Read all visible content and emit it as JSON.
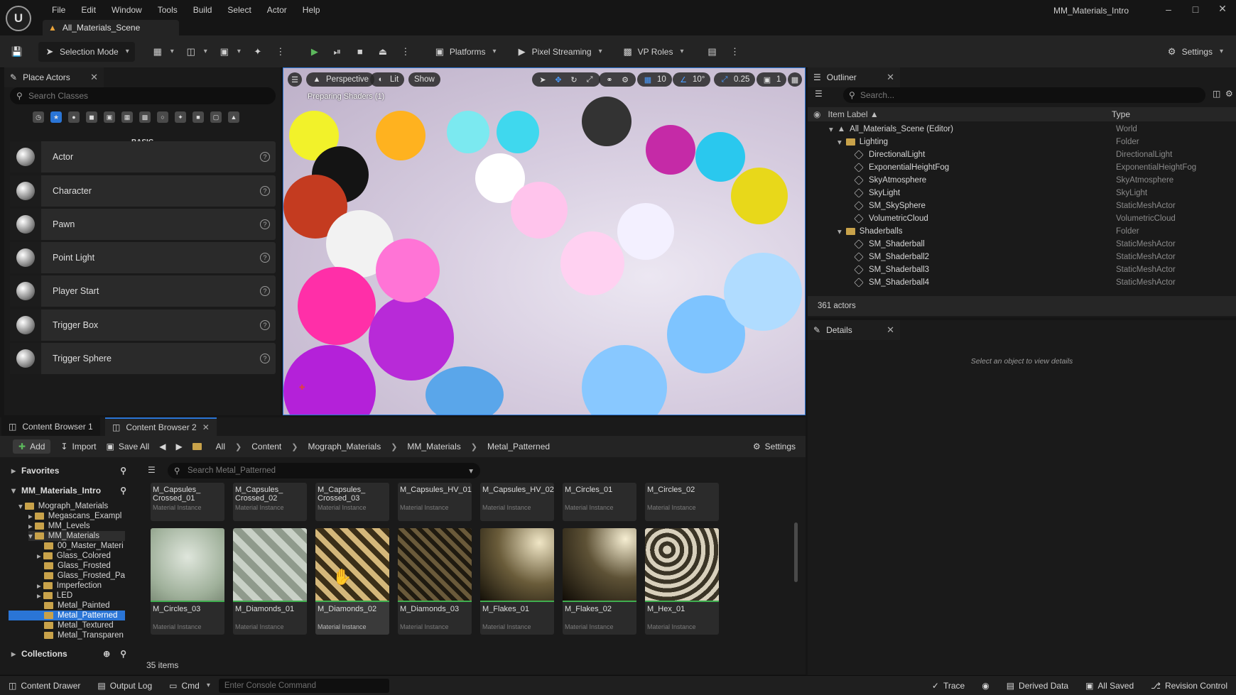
{
  "window": {
    "project_name": "MM_Materials_Intro",
    "level_tab": "All_Materials_Scene",
    "minimize": "–",
    "maximize": "□",
    "close": "✕"
  },
  "menu": [
    "File",
    "Edit",
    "Window",
    "Tools",
    "Build",
    "Select",
    "Actor",
    "Help"
  ],
  "toolbar": {
    "selection_mode": "Selection Mode",
    "platforms": "Platforms",
    "pixel_streaming": "Pixel Streaming",
    "vp_roles": "VP Roles",
    "settings": "Settings"
  },
  "place_actors": {
    "title": "Place Actors",
    "search_placeholder": "Search Classes",
    "section_label": "BASIC",
    "items": [
      {
        "label": "Actor"
      },
      {
        "label": "Character"
      },
      {
        "label": "Pawn"
      },
      {
        "label": "Point Light"
      },
      {
        "label": "Player Start"
      },
      {
        "label": "Trigger Box"
      },
      {
        "label": "Trigger Sphere"
      }
    ]
  },
  "viewport": {
    "perspective": "Perspective",
    "lit": "Lit",
    "show": "Show",
    "grid_snap": "10",
    "rotate_snap": "10°",
    "scale_snap": "0.25",
    "camera_speed": "1",
    "status": "Preparing Shaders (1)"
  },
  "outliner": {
    "title": "Outliner",
    "search_placeholder": "Search...",
    "col_label": "Item Label ▲",
    "col_type": "Type",
    "rows": [
      {
        "label": "All_Materials_Scene (Editor)",
        "type": "World"
      },
      {
        "label": "Lighting",
        "type": "Folder"
      },
      {
        "label": "DirectionalLight",
        "type": "DirectionalLight"
      },
      {
        "label": "ExponentialHeightFog",
        "type": "ExponentialHeightFog"
      },
      {
        "label": "SkyAtmosphere",
        "type": "SkyAtmosphere"
      },
      {
        "label": "SkyLight",
        "type": "SkyLight"
      },
      {
        "label": "SM_SkySphere",
        "type": "StaticMeshActor"
      },
      {
        "label": "VolumetricCloud",
        "type": "VolumetricCloud"
      },
      {
        "label": "Shaderballs",
        "type": "Folder"
      },
      {
        "label": "SM_Shaderball",
        "type": "StaticMeshActor"
      },
      {
        "label": "SM_Shaderball2",
        "type": "StaticMeshActor"
      },
      {
        "label": "SM_Shaderball3",
        "type": "StaticMeshActor"
      },
      {
        "label": "SM_Shaderball4",
        "type": "StaticMeshActor"
      }
    ],
    "count": "361 actors"
  },
  "details": {
    "title": "Details",
    "empty": "Select an object to view details"
  },
  "content_browser": {
    "tab1": "Content Browser 1",
    "tab2": "Content Browser 2",
    "add": "Add",
    "import": "Import",
    "save_all": "Save All",
    "settings": "Settings",
    "breadcrumbs": [
      "All",
      "Content",
      "Mograph_Materials",
      "MM_Materials",
      "Metal_Patterned"
    ],
    "favorites": "Favorites",
    "project": "MM_Materials_Intro",
    "collections": "Collections",
    "search_placeholder": "Search Metal_Patterned",
    "tree": [
      {
        "label": "Mograph_Materials"
      },
      {
        "label": "Megascans_Exampl"
      },
      {
        "label": "MM_Levels"
      },
      {
        "label": "MM_Materials"
      },
      {
        "label": "00_Master_Materi"
      },
      {
        "label": "Glass_Colored"
      },
      {
        "label": "Glass_Frosted"
      },
      {
        "label": "Glass_Frosted_Pa"
      },
      {
        "label": "Imperfection"
      },
      {
        "label": "LED"
      },
      {
        "label": "Metal_Painted"
      },
      {
        "label": "Metal_Patterned"
      },
      {
        "label": "Metal_Textured"
      },
      {
        "label": "Metal_Transparen"
      }
    ],
    "top_assets": [
      {
        "name": "M_Capsules_\nCrossed_01",
        "type": "Material Instance"
      },
      {
        "name": "M_Capsules_\nCrossed_02",
        "type": "Material Instance"
      },
      {
        "name": "M_Capsules_\nCrossed_03",
        "type": "Material Instance"
      },
      {
        "name": "M_Capsules_HV_01",
        "type": "Material Instance"
      },
      {
        "name": "M_Capsules_HV_02",
        "type": "Material Instance"
      },
      {
        "name": "M_Circles_01",
        "type": "Material Instance"
      },
      {
        "name": "M_Circles_02",
        "type": "Material Instance"
      }
    ],
    "assets": [
      {
        "name": "M_Circles_03",
        "type": "Material Instance"
      },
      {
        "name": "M_Diamonds_01",
        "type": "Material Instance"
      },
      {
        "name": "M_Diamonds_02",
        "type": "Material Instance"
      },
      {
        "name": "M_Diamonds_03",
        "type": "Material Instance"
      },
      {
        "name": "M_Flakes_01",
        "type": "Material Instance"
      },
      {
        "name": "M_Flakes_02",
        "type": "Material Instance"
      },
      {
        "name": "M_Hex_01",
        "type": "Material Instance"
      }
    ],
    "items_count": "35 items"
  },
  "statusbar": {
    "content_drawer": "Content Drawer",
    "output_log": "Output Log",
    "cmd": "Cmd",
    "console_placeholder": "Enter Console Command",
    "trace": "Trace",
    "derived_data": "Derived Data",
    "all_saved": "All Saved",
    "revision_control": "Revision Control"
  }
}
